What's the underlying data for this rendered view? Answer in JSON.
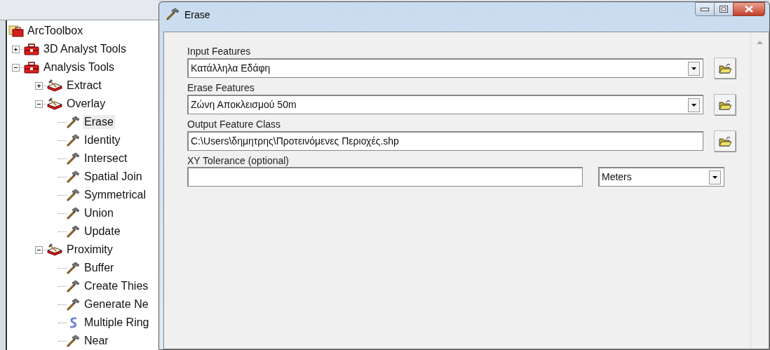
{
  "tree": [
    {
      "label": "ArcToolbox",
      "kind": "root",
      "selected": false,
      "children": [
        {
          "label": "3D Analyst Tools",
          "kind": "toolbox",
          "expanded": false,
          "selected": false
        },
        {
          "label": "Analysis Tools",
          "kind": "toolbox",
          "expanded": true,
          "selected": false,
          "children": [
            {
              "label": "Extract",
              "kind": "toolset",
              "expanded": false,
              "selected": false
            },
            {
              "label": "Overlay",
              "kind": "toolset",
              "expanded": true,
              "selected": false,
              "children": [
                {
                  "label": "Erase",
                  "kind": "tool",
                  "selected": true
                },
                {
                  "label": "Identity",
                  "kind": "tool",
                  "selected": false
                },
                {
                  "label": "Intersect",
                  "kind": "tool",
                  "selected": false
                },
                {
                  "label": "Spatial Join",
                  "kind": "tool",
                  "selected": false
                },
                {
                  "label": "Symmetrical",
                  "kind": "tool",
                  "selected": false
                },
                {
                  "label": "Union",
                  "kind": "tool",
                  "selected": false
                },
                {
                  "label": "Update",
                  "kind": "tool",
                  "selected": false
                }
              ]
            },
            {
              "label": "Proximity",
              "kind": "toolset",
              "expanded": true,
              "selected": false,
              "children": [
                {
                  "label": "Buffer",
                  "kind": "tool",
                  "selected": false
                },
                {
                  "label": "Create Thies",
                  "kind": "tool",
                  "selected": false
                },
                {
                  "label": "Generate Ne",
                  "kind": "tool",
                  "selected": false
                },
                {
                  "label": "Multiple Ring",
                  "kind": "script",
                  "selected": false
                },
                {
                  "label": "Near",
                  "kind": "tool",
                  "selected": false
                }
              ]
            }
          ]
        }
      ]
    }
  ],
  "dialog": {
    "title": "Erase",
    "fields": [
      {
        "label": "Input Features",
        "kind": "combo",
        "value": "Κατάλληλα Εδάφη"
      },
      {
        "label": "Erase Features",
        "kind": "combo",
        "value": "Ζώνη Αποκλεισμού 50m"
      },
      {
        "label": "Output Feature Class",
        "kind": "path",
        "value": "C:\\Users\\δημητρης\\Προτεινόμενες Περιοχές.shp"
      },
      {
        "label": "XY Tolerance (optional)",
        "kind": "measure",
        "units": "Meters"
      }
    ]
  }
}
